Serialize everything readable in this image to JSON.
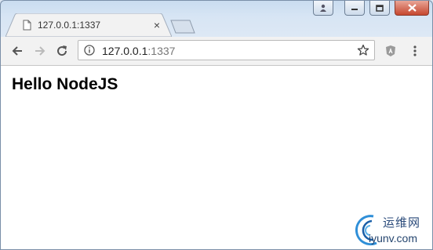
{
  "browser": {
    "tab": {
      "title": "127.0.0.1:1337",
      "close_label": "×"
    },
    "address": {
      "host": "127.0.0.1",
      "port": ":1337"
    }
  },
  "page": {
    "heading": "Hello NodeJS"
  },
  "watermark": {
    "brand": "运维网",
    "site": "iyunv.com"
  },
  "colors": {
    "window_frame": "#c9dcf0",
    "toolbar": "#f2f2f2",
    "close_button": "#c6472f"
  },
  "icons": [
    "page-icon",
    "back-icon",
    "forward-icon",
    "reload-icon",
    "info-icon",
    "star-icon",
    "extension-icon",
    "menu-icon"
  ]
}
